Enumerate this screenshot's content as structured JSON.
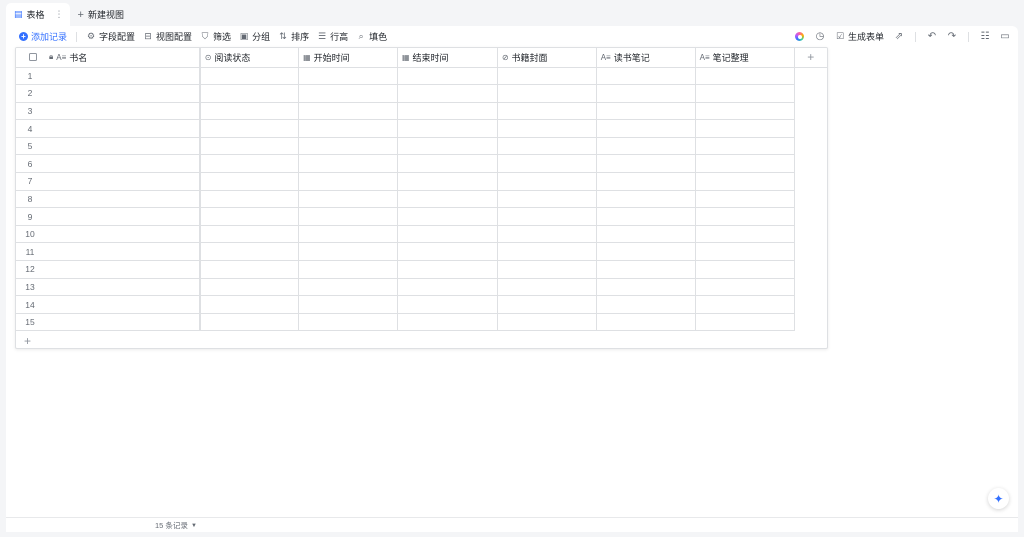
{
  "tabs": {
    "active": {
      "label": "表格",
      "icon": "table-icon",
      "more": "⋮"
    },
    "add": {
      "label": "新建视图",
      "icon": "plus-icon"
    }
  },
  "toolbar": {
    "add_record": "添加记录",
    "field_config": "字段配置",
    "view_config": "视图配置",
    "filter": "筛选",
    "group": "分组",
    "sort": "排序",
    "row_height": "行高",
    "fill_color": "填色",
    "generate_form": "生成表单"
  },
  "table": {
    "columns": [
      {
        "name": "书名",
        "icon": "text-field-icon",
        "glyph": "A≡"
      },
      {
        "name": "阅读状态",
        "icon": "single-select-icon",
        "glyph": "⊙"
      },
      {
        "name": "开始时间",
        "icon": "date-icon",
        "glyph": "▦"
      },
      {
        "name": "结束时间",
        "icon": "date-icon",
        "glyph": "▦"
      },
      {
        "name": "书籍封面",
        "icon": "attachment-icon",
        "glyph": "⊘"
      },
      {
        "name": "读书笔记",
        "icon": "text-field-icon",
        "glyph": "A≡"
      },
      {
        "name": "笔记整理",
        "icon": "text-field-icon",
        "glyph": "A≡"
      }
    ],
    "row_numbers": [
      "1",
      "2",
      "3",
      "4",
      "5",
      "6",
      "7",
      "8",
      "9",
      "10",
      "11",
      "12",
      "13",
      "14",
      "15"
    ],
    "add_column": "+",
    "add_row": "+"
  },
  "footer": {
    "record_count": "15 条记录"
  },
  "colors": {
    "accent": "#3370ff",
    "border": "#dee0e3",
    "background": "#f4f5f7"
  }
}
